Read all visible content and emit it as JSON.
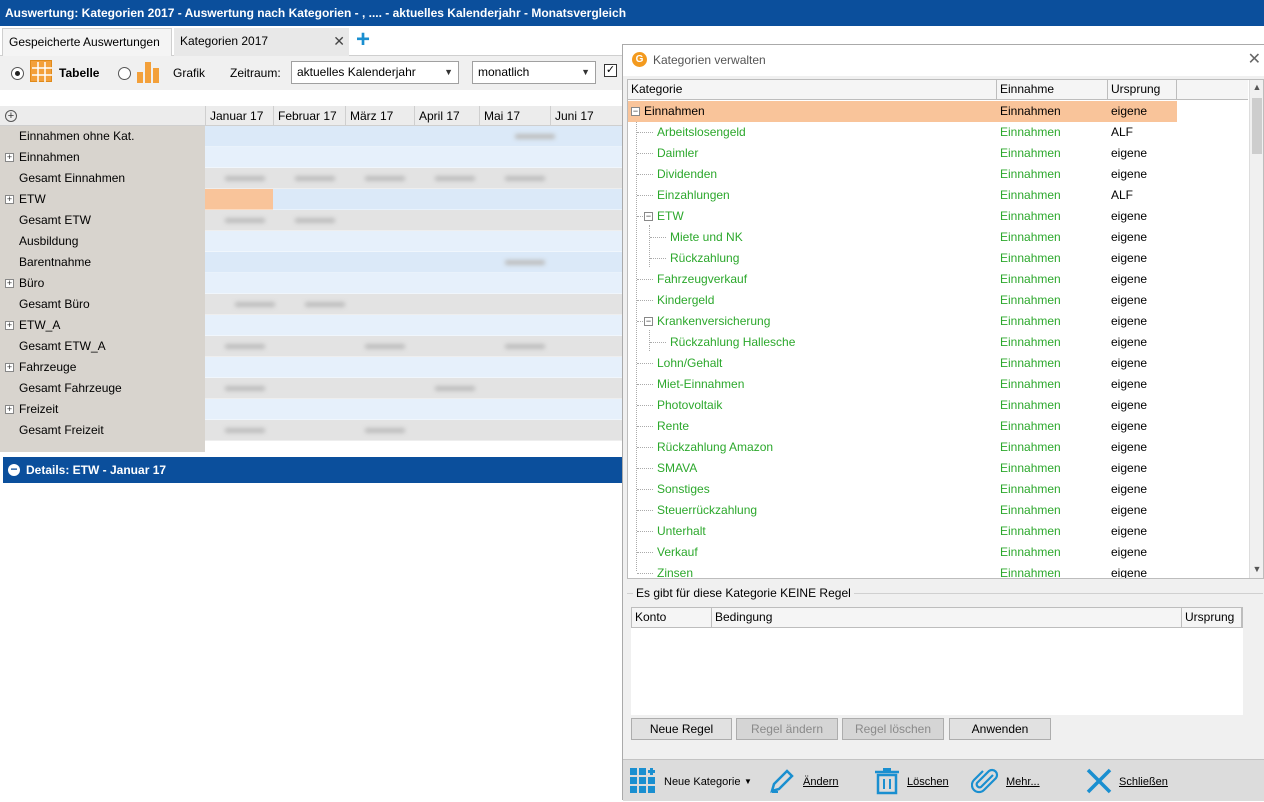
{
  "window": {
    "title": "Auswertung: Kategorien 2017 - Auswertung nach Kategorien - , .... - aktuelles Kalenderjahr - Monatsvergleich"
  },
  "tabs": [
    {
      "label": "Gespeicherte Auswertungen"
    },
    {
      "label": "Kategorien 2017"
    }
  ],
  "tab_close": "✕",
  "tab_add": "+",
  "toolbar": {
    "table_label": "Tabelle",
    "chart_label": "Grafik",
    "period_label": "Zeitraum:",
    "period_value": "aktuelles Kalenderjahr",
    "interval_value": "monatlich"
  },
  "grid": {
    "months": [
      "Januar 17",
      "Februar 17",
      "März 17",
      "April 17",
      "Mai 17",
      "Juni 17"
    ],
    "rows": [
      "Einnahmen ohne Kat.",
      "Einnahmen",
      "Gesamt Einnahmen",
      "ETW",
      "Gesamt ETW",
      "Ausbildung",
      "Barentnahme",
      "Büro",
      "Gesamt Büro",
      "ETW_A",
      "Gesamt ETW_A",
      "Fahrzeuge",
      "Gesamt Fahrzeuge",
      "Freizeit",
      "Gesamt Freizeit"
    ]
  },
  "details": {
    "title": "Details: ETW - Januar 17"
  },
  "dialog": {
    "title": "Kategorien verwalten",
    "columns": [
      "Kategorie",
      "Einnahme",
      "Ursprung"
    ],
    "categories": [
      {
        "name": "Einnahmen",
        "type": "Einnahmen",
        "origin": "eigene"
      },
      {
        "name": "Arbeitslosengeld",
        "type": "Einnahmen",
        "origin": "ALF"
      },
      {
        "name": "Daimler",
        "type": "Einnahmen",
        "origin": "eigene"
      },
      {
        "name": "Dividenden",
        "type": "Einnahmen",
        "origin": "eigene"
      },
      {
        "name": "Einzahlungen",
        "type": "Einnahmen",
        "origin": "ALF"
      },
      {
        "name": "ETW",
        "type": "Einnahmen",
        "origin": "eigene"
      },
      {
        "name": "Miete und NK",
        "type": "Einnahmen",
        "origin": "eigene"
      },
      {
        "name": "Rückzahlung",
        "type": "Einnahmen",
        "origin": "eigene"
      },
      {
        "name": "Fahrzeugverkauf",
        "type": "Einnahmen",
        "origin": "eigene"
      },
      {
        "name": "Kindergeld",
        "type": "Einnahmen",
        "origin": "eigene"
      },
      {
        "name": "Krankenversicherung",
        "type": "Einnahmen",
        "origin": "eigene"
      },
      {
        "name": "Rückzahlung Hallesche",
        "type": "Einnahmen",
        "origin": "eigene"
      },
      {
        "name": "Lohn/Gehalt",
        "type": "Einnahmen",
        "origin": "eigene"
      },
      {
        "name": "Miet-Einnahmen",
        "type": "Einnahmen",
        "origin": "eigene"
      },
      {
        "name": "Photovoltaik",
        "type": "Einnahmen",
        "origin": "eigene"
      },
      {
        "name": "Rente",
        "type": "Einnahmen",
        "origin": "eigene"
      },
      {
        "name": "Rückzahlung Amazon",
        "type": "Einnahmen",
        "origin": "eigene"
      },
      {
        "name": "SMAVA",
        "type": "Einnahmen",
        "origin": "eigene"
      },
      {
        "name": "Sonstiges",
        "type": "Einnahmen",
        "origin": "eigene"
      },
      {
        "name": "Steuerrückzahlung",
        "type": "Einnahmen",
        "origin": "eigene"
      },
      {
        "name": "Unterhalt",
        "type": "Einnahmen",
        "origin": "eigene"
      },
      {
        "name": "Verkauf",
        "type": "Einnahmen",
        "origin": "eigene"
      },
      {
        "name": "Zinsen",
        "type": "Einnahmen",
        "origin": "eigene"
      }
    ],
    "rules_title": "Es gibt für diese Kategorie KEINE Regel",
    "rules_columns": [
      "Konto",
      "Bedingung",
      "Ursprung"
    ],
    "buttons": {
      "new_rule": "Neue Regel",
      "edit_rule": "Regel ändern",
      "delete_rule": "Regel löschen",
      "apply": "Anwenden"
    },
    "bottom": {
      "new_category": "Neue Kategorie",
      "edit": "Ändern",
      "delete": "Löschen",
      "more": "Mehr...",
      "close": "Schließen"
    }
  },
  "colors": {
    "header_blue": "#0b4f9c",
    "income_green": "#2ca82c",
    "selection_orange": "#f9c49a",
    "accent_blue": "#1a8fd0"
  }
}
